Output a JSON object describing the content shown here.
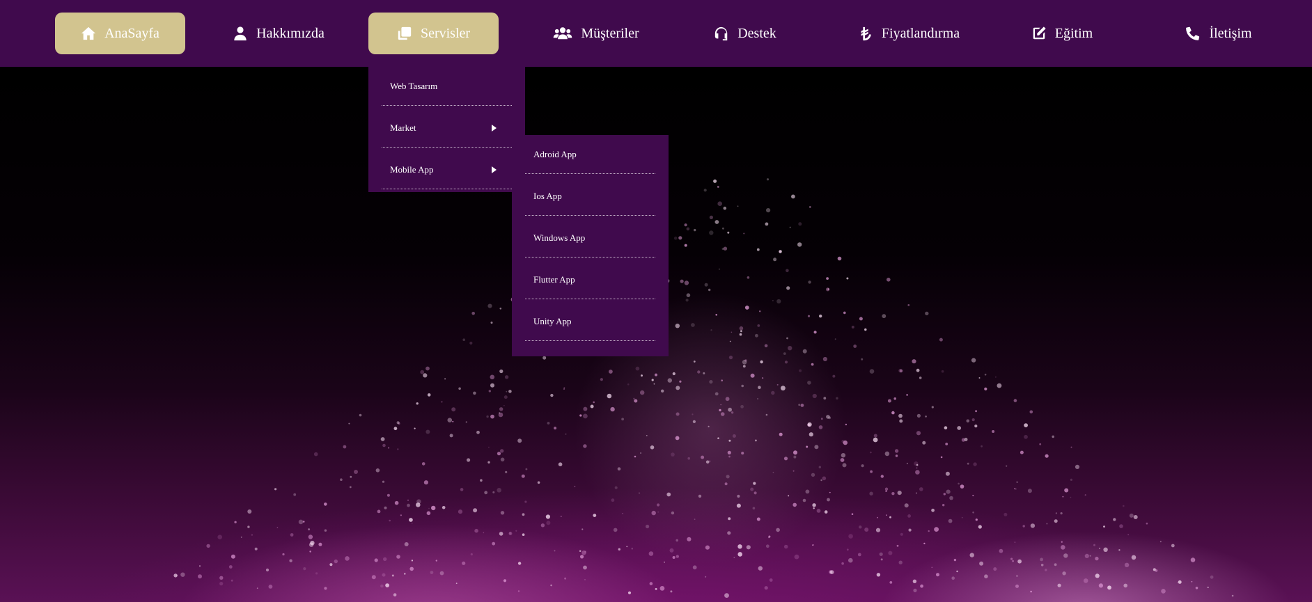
{
  "nav": {
    "items": [
      {
        "label": "AnaSayfa",
        "icon": "home-icon",
        "active": true
      },
      {
        "label": "Hakkımızda",
        "icon": "user-icon",
        "active": false
      },
      {
        "label": "Servisler",
        "icon": "copy-icon",
        "active": true
      },
      {
        "label": "Müşteriler",
        "icon": "users-icon",
        "active": false
      },
      {
        "label": "Destek",
        "icon": "headset-icon",
        "active": false
      },
      {
        "label": "Fiyatlandırma",
        "icon": "lira-icon",
        "active": false
      },
      {
        "label": "Eğitim",
        "icon": "edit-icon",
        "active": false
      },
      {
        "label": "İletişim",
        "icon": "phone-icon",
        "active": false
      }
    ]
  },
  "services_menu": {
    "items": [
      {
        "label": "Web Tasarım",
        "has_submenu": false
      },
      {
        "label": "Market",
        "has_submenu": true
      },
      {
        "label": "Mobile App",
        "has_submenu": true
      }
    ]
  },
  "mobile_app_menu": {
    "items": [
      {
        "label": "Adroid App"
      },
      {
        "label": "Ios App"
      },
      {
        "label": "Windows App"
      },
      {
        "label": "Flutter App"
      },
      {
        "label": "Unity App"
      }
    ]
  },
  "colors": {
    "navbar_bg": "#400a4d",
    "active_bg": "#d2c48f",
    "text": "#ffffff"
  }
}
